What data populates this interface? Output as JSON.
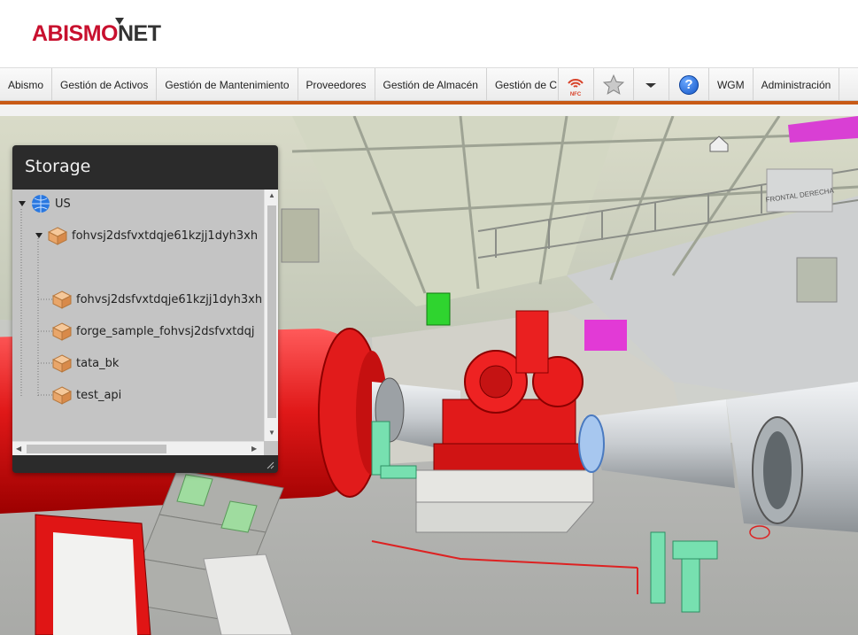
{
  "header": {
    "logo_part1": "ABISMO",
    "logo_part2": "NET"
  },
  "navbar": {
    "items": [
      "Abismo",
      "Gestión de Activos",
      "Gestión de Mantenimiento",
      "Proveedores",
      "Gestión de Almacén",
      "Gestión de C"
    ],
    "nfc_label": "NFC",
    "star_icon": "star-icon",
    "dropdown_icon": "chevron-down-icon",
    "help_glyph": "?",
    "wgm_label": "WGM",
    "admin_label": "Administración",
    "accent_color": "#c85a16"
  },
  "viewer": {
    "sign_label": "FRONTAL DERECHA"
  },
  "storage_panel": {
    "title": "Storage",
    "tree": {
      "root": "US",
      "items": [
        "fohvsj2dsfvxtdqje61kzjj1dyh3xh",
        "fohvsj2dsfvxtdqje61kzjj1dyh3xh",
        "forge_sample_fohvsj2dsfvxtdqj",
        "tata_bk",
        "test_api"
      ]
    }
  }
}
